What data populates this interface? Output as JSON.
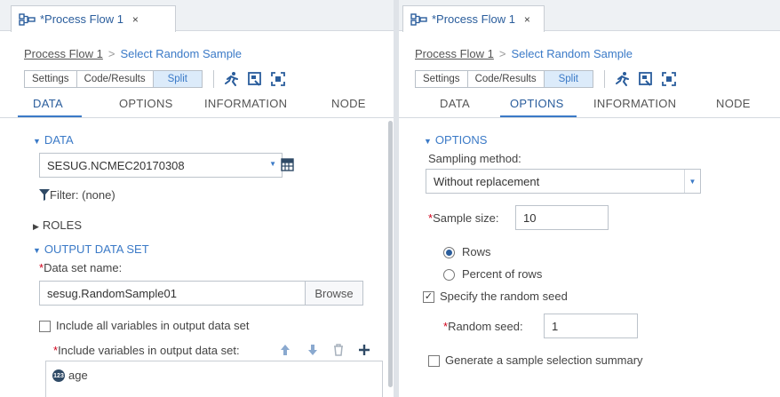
{
  "left": {
    "tab": {
      "title": "*Process Flow 1",
      "close": "×"
    },
    "breadcrumb": {
      "root": "Process Flow 1",
      "sep": ">",
      "current": "Select Random Sample"
    },
    "toolbar": {
      "settings": "Settings",
      "code_results": "Code/Results",
      "split": "Split"
    },
    "nav": [
      "DATA",
      "OPTIONS",
      "INFORMATION",
      "NODE"
    ],
    "active_tab": "DATA",
    "data_section": {
      "title": "DATA",
      "table": "SESUG.NCMEC20170308",
      "filter": "Filter: (none)"
    },
    "roles": "ROLES",
    "output_section": {
      "title": "OUTPUT DATA SET",
      "req_mark": "*",
      "dataset_label": "Data set name:",
      "dataset_value": "sesug.RandomSample01",
      "browse": "Browse",
      "include_all_label": "Include all variables in output data set",
      "include_all_checked": false,
      "include_vars_label": "Include variables in output data set:",
      "variables": [
        "age"
      ]
    }
  },
  "right": {
    "tab": {
      "title": "*Process Flow 1",
      "close": "×"
    },
    "breadcrumb": {
      "root": "Process Flow 1",
      "sep": ">",
      "current": "Select Random Sample"
    },
    "toolbar": {
      "settings": "Settings",
      "code_results": "Code/Results",
      "split": "Split"
    },
    "nav": [
      "DATA",
      "OPTIONS",
      "INFORMATION",
      "NODE"
    ],
    "active_tab": "OPTIONS",
    "options": {
      "title": "OPTIONS",
      "sampling_label": "Sampling method:",
      "sampling_value": "Without replacement",
      "req_mark": "*",
      "sample_size_label": "Sample size:",
      "sample_size_value": "10",
      "unit_options": [
        "Rows",
        "Percent of rows"
      ],
      "unit_selected": "Rows",
      "seed_check_label": "Specify the random seed",
      "seed_checked": true,
      "seed_label": "Random seed:",
      "seed_value": "1",
      "summary_label": "Generate a sample selection summary",
      "summary_checked": false
    }
  },
  "colors": {
    "accent": "#3b7ac7",
    "required": "#d0021b",
    "active_segment": "#dcebfa"
  }
}
